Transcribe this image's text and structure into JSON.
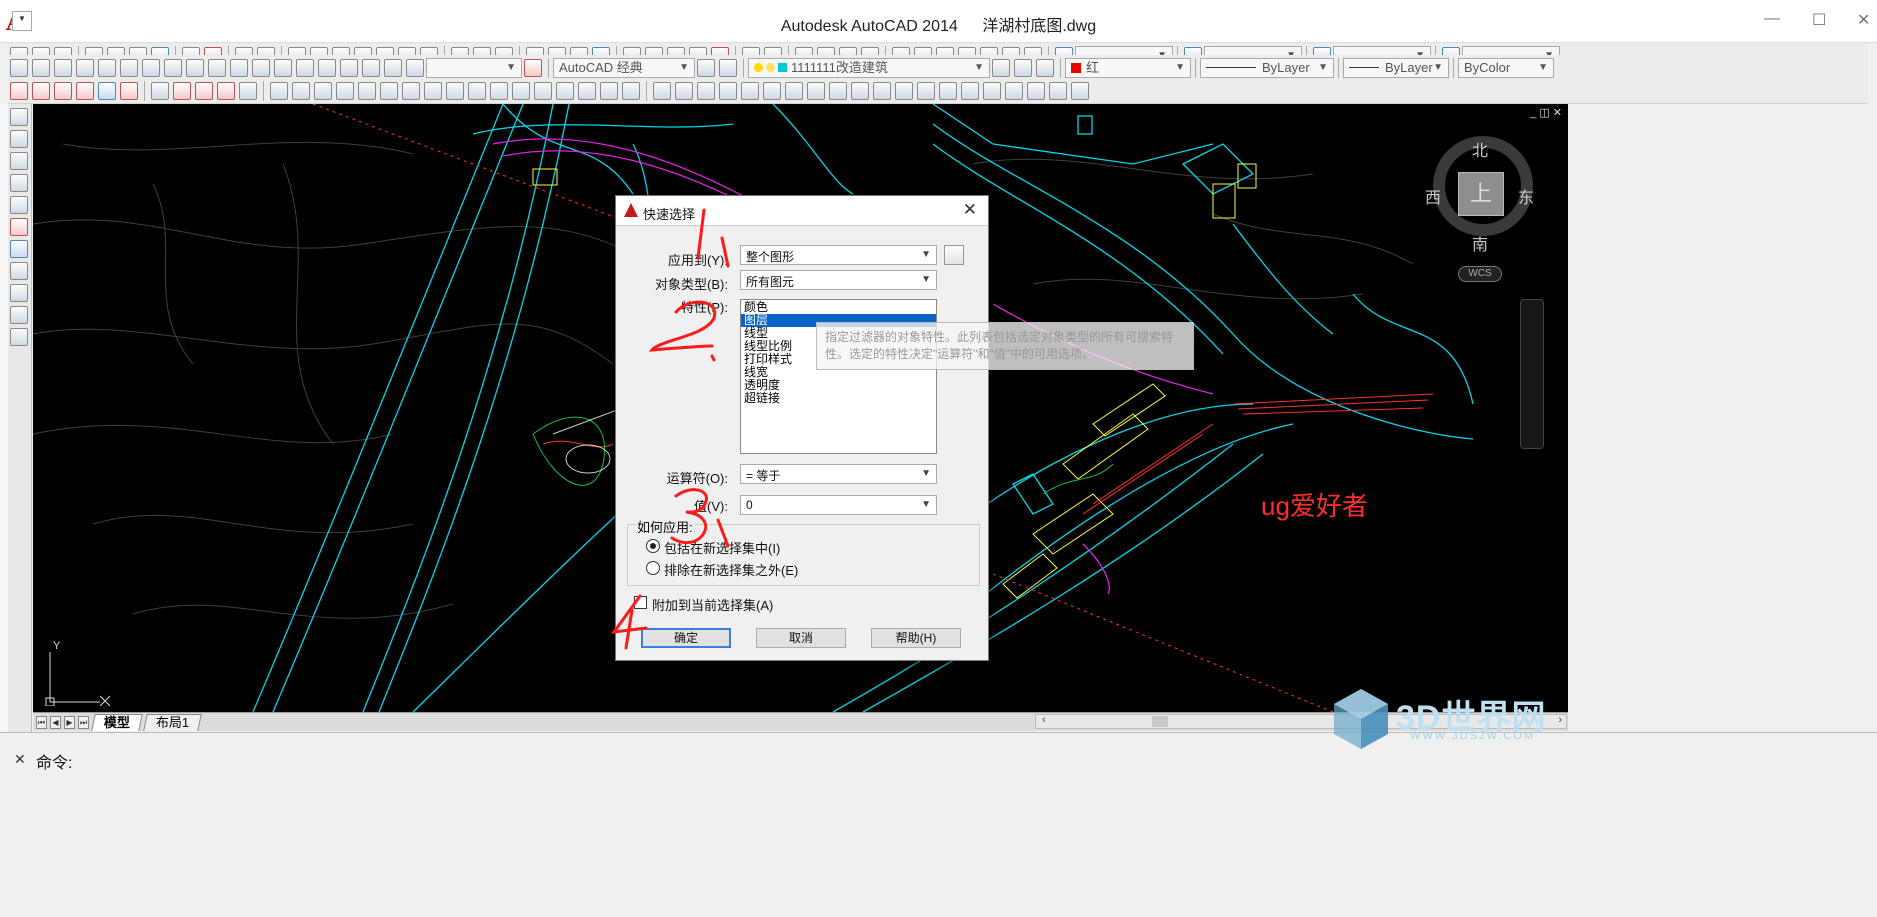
{
  "app": {
    "title": "Autodesk AutoCAD 2014",
    "file": "洋湖村底图.dwg",
    "logo_icon": "autocad-a-icon"
  },
  "toolbar2": {
    "workspace": "AutoCAD 经典",
    "layer": "1111111改造建筑",
    "color": "红",
    "linetype": "ByLayer",
    "lineweight": "ByLayer",
    "plotstyle": "ByColor"
  },
  "viewcube": {
    "north": "北",
    "south": "南",
    "east": "东",
    "west": "西",
    "face": "上",
    "wcs": "WCS"
  },
  "ucs": {
    "y": "Y"
  },
  "tabs": {
    "model": "模型",
    "layout1": "布局1"
  },
  "command": {
    "prompt": "命令:"
  },
  "watermark": "ug爱好者",
  "logo": {
    "name": "3D世界网",
    "url": "WWW.3DSJW.COM"
  },
  "dialog": {
    "title": "快速选择",
    "apply_to_label": "应用到(Y):",
    "apply_to_value": "整个图形",
    "object_type_label": "对象类型(B):",
    "object_type_value": "所有图元",
    "properties_label": "特性(P):",
    "properties": [
      "颜色",
      "图层",
      "线型",
      "线型比例",
      "打印样式",
      "线宽",
      "透明度",
      "超链接"
    ],
    "selected_property": "图层",
    "operator_label": "运算符(O):",
    "operator_value": "= 等于",
    "value_label": "值(V):",
    "value_value": "0",
    "how_apply_label": "如何应用:",
    "include_label": "包括在新选择集中(I)",
    "exclude_label": "排除在新选择集之外(E)",
    "append_label": "附加到当前选择集(A)",
    "ok": "确定",
    "cancel": "取消",
    "help": "帮助(H)",
    "tooltip": "指定过滤器的对象特性。此列表包括选定对象类型的所有可搜索特性。选定的特性决定\"运算符\"和\"值\"中的可用选项。"
  },
  "colors": {
    "canvas": "#000000",
    "cyan": "#00d8e8",
    "magenta": "#e020e0",
    "annotation": "#ff1a1a"
  }
}
